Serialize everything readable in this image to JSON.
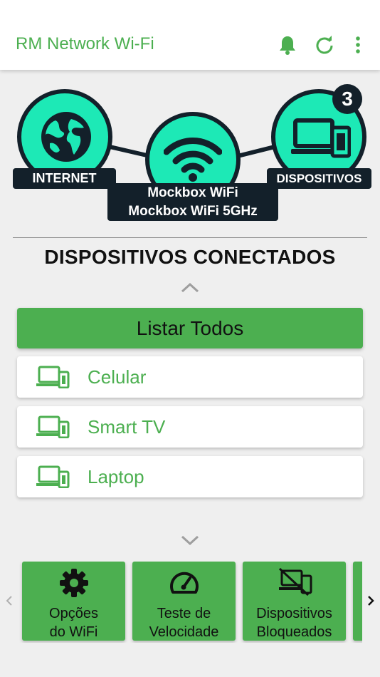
{
  "appbar": {
    "title": "RM Network Wi-Fi",
    "icons": [
      "bell-icon",
      "refresh-icon",
      "more-vert-icon"
    ]
  },
  "network": {
    "internet_label": "INTERNET",
    "wifi_names": [
      "Mockbox WiFi",
      "Mockbox WiFi 5GHz"
    ],
    "devices_label": "DISPOSITIVOS",
    "device_count": "3"
  },
  "section": {
    "title": "DISPOSITIVOS CONECTADOS"
  },
  "list_all_label": "Listar Todos",
  "devices": [
    {
      "label": "Celular",
      "icon": "devices-icon"
    },
    {
      "label": "Smart TV",
      "icon": "devices-icon"
    },
    {
      "label": "Laptop",
      "icon": "devices-icon"
    }
  ],
  "tiles": [
    {
      "label_line1": "Opções",
      "label_line2": "do WiFi",
      "icon": "gear-icon"
    },
    {
      "label_line1": "Teste de",
      "label_line2": "Velocidade",
      "icon": "speedometer-icon"
    },
    {
      "label_line1": "Dispositivos",
      "label_line2": "Bloqueados",
      "icon": "devices-off-icon"
    }
  ],
  "colors": {
    "accent": "#4caf50",
    "node_fill": "#1de9b6",
    "dark": "#13202a",
    "background": "#efefef"
  }
}
